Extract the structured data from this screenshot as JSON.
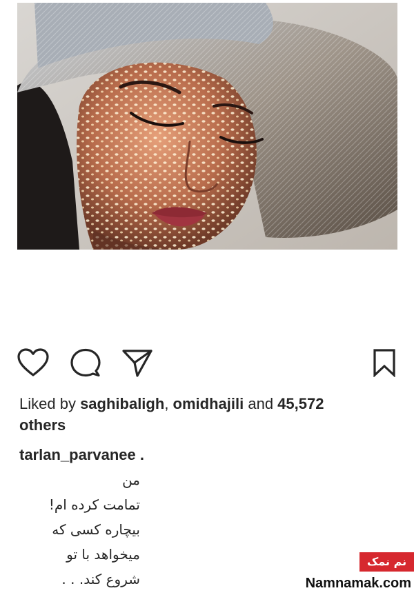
{
  "post": {
    "image_alt": "Woman wearing a straw hat with dappled light on her face"
  },
  "actions": {
    "like_icon": "heart-icon",
    "comment_icon": "comment-icon",
    "share_icon": "paper-plane-icon",
    "save_icon": "bookmark-icon"
  },
  "likes": {
    "prefix": "Liked by ",
    "user1": "saghibaligh",
    "separator": ", ",
    "user2": "omidhajili",
    "middle": " and ",
    "count": "45,572",
    "suffix": "others"
  },
  "caption": {
    "username": "tarlan_parvanee .",
    "lines": [
      "من",
      "تمامت کرده ام!",
      "بیچاره کسی که",
      "میخواهد با تو",
      "شروع کند. . ."
    ]
  },
  "watermark": {
    "badge": "نم نمک",
    "site": "Namnamak.com",
    "badge_color": "#d6282e"
  }
}
